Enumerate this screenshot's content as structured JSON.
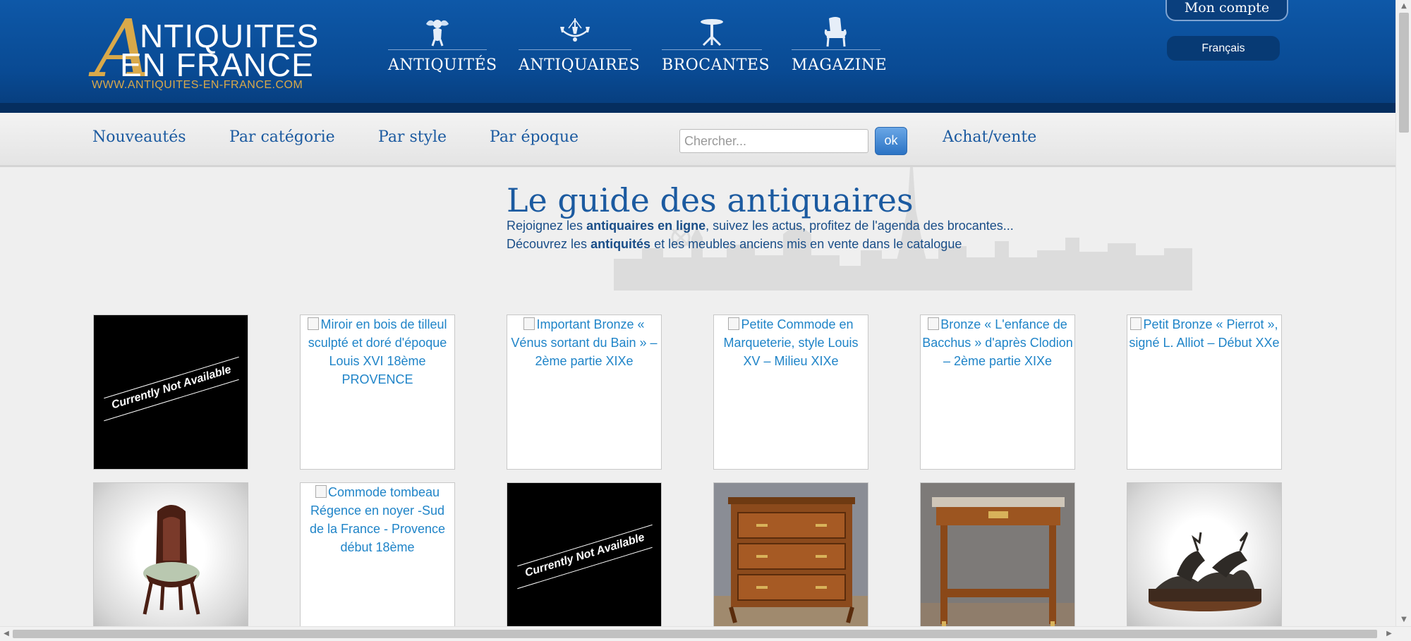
{
  "logo": {
    "big_letter": "A",
    "line1": "NTIQUITES",
    "line2": "EN FRANCE",
    "url": "WWW.ANTIQUITES-EN-FRANCE.COM"
  },
  "topnav": [
    {
      "label": "ANTIQUITÉS",
      "icon": "cherub-icon"
    },
    {
      "label": "ANTIQUAIRES",
      "icon": "chandelier-icon"
    },
    {
      "label": "BROCANTES",
      "icon": "pedestal-table-icon"
    },
    {
      "label": "MAGAZINE",
      "icon": "armchair-icon"
    }
  ],
  "account": {
    "label": "Mon compte"
  },
  "language": {
    "label": "Français"
  },
  "subnav": {
    "links": [
      "Nouveautés",
      "Par catégorie",
      "Par style",
      "Par époque"
    ],
    "search_placeholder": "Chercher...",
    "search_button": "ok",
    "extra_link": "Achat/vente"
  },
  "guide": {
    "title": "Le guide des antiquaires",
    "line1_pre": "Rejoignez les ",
    "line1_bold": "antiquaires en ligne",
    "line1_post": ", suivez les actus, profitez de l'agenda des brocantes...",
    "line2_pre": "Découvrez les ",
    "line2_bold": "antiquités",
    "line2_post": " et les meubles anciens mis en vente dans le catalogue"
  },
  "cards": {
    "row1": [
      {
        "kind": "na",
        "text": "Currently Not Available"
      },
      {
        "kind": "alt",
        "text": "Miroir en bois de tilleul sculpté et doré d'époque Louis XVI 18ème PROVENCE"
      },
      {
        "kind": "alt",
        "text": "Important Bronze « Vénus sortant du Bain » – 2ème partie XIXe"
      },
      {
        "kind": "alt",
        "text": "Petite Commode en Marqueterie, style Louis XV – Milieu XIXe"
      },
      {
        "kind": "alt",
        "text": "Bronze « L'enfance de Bacchus » d'après Clodion – 2ème partie XIXe"
      },
      {
        "kind": "alt",
        "text": "Petit Bronze « Pierrot », signé L. Alliot – Début XXe"
      }
    ],
    "row2": [
      {
        "kind": "photo",
        "subject": "chair-photo"
      },
      {
        "kind": "alt",
        "text": "Commode tombeau Régence en noyer -Sud de la France - Provence début 18ème"
      },
      {
        "kind": "na",
        "text": "Currently Not Available"
      },
      {
        "kind": "photo",
        "subject": "commode-photo"
      },
      {
        "kind": "photo",
        "subject": "console-table-photo"
      },
      {
        "kind": "photo",
        "subject": "bronze-deer-photo"
      }
    ]
  },
  "colors": {
    "header_blue": "#0b4f9c",
    "header_band": "#052e5f",
    "gold": "#d9a94a",
    "link_blue": "#1b5aa0",
    "alt_text_blue": "#1f84c8"
  }
}
